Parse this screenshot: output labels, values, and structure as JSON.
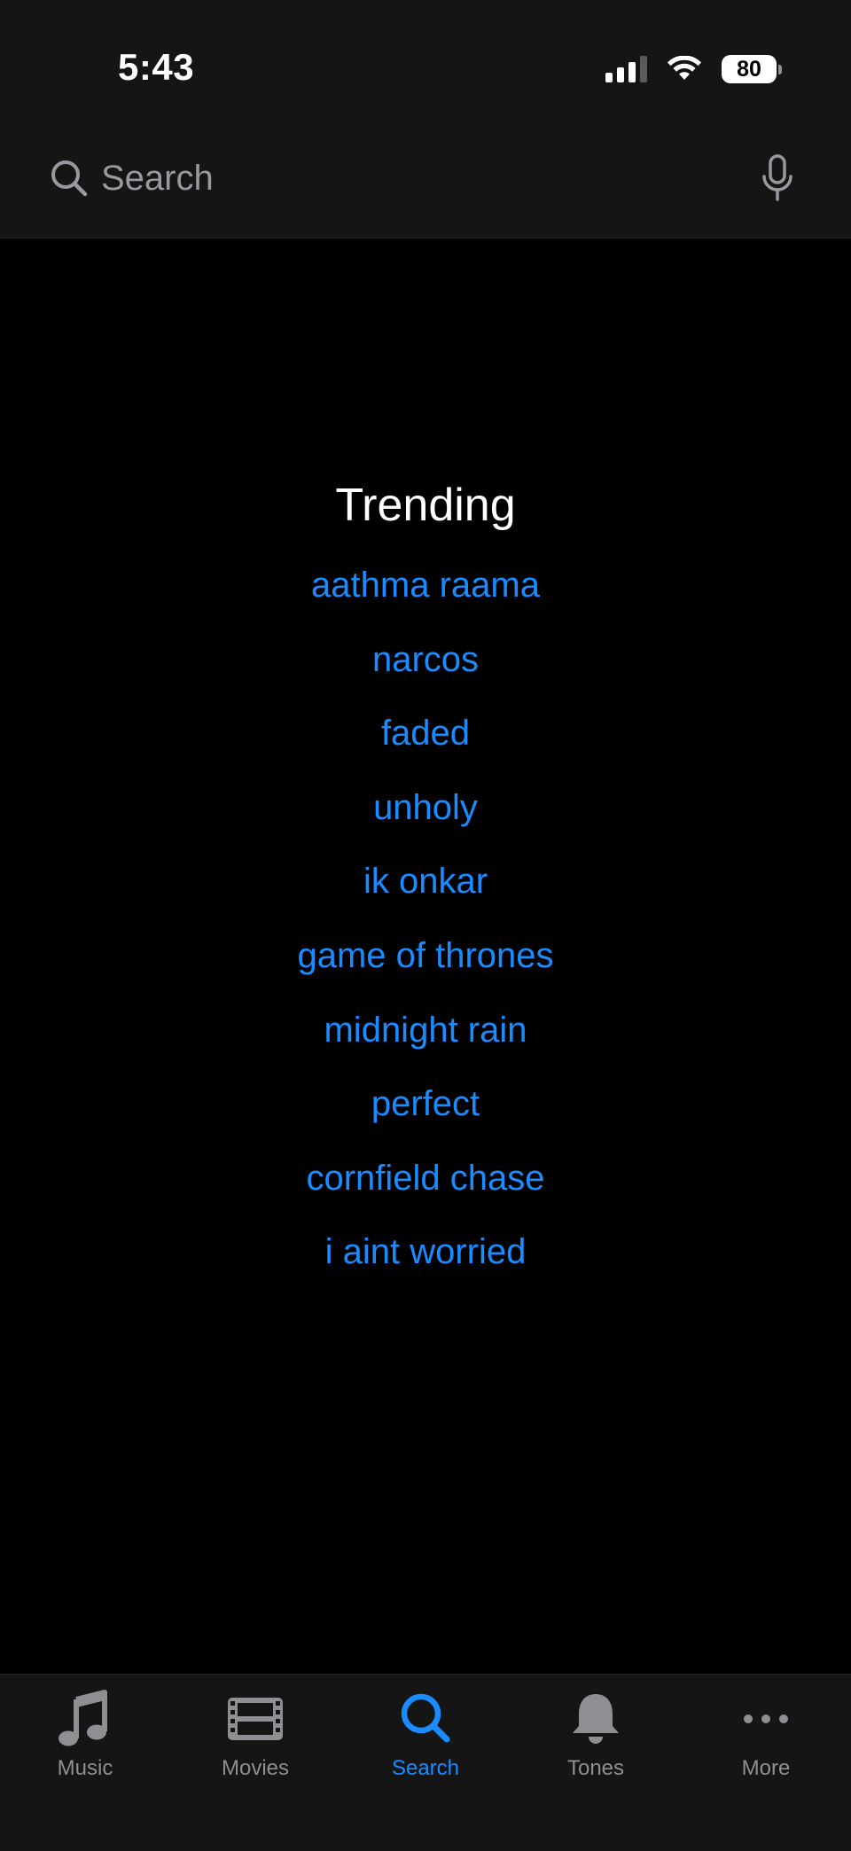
{
  "status_bar": {
    "time": "5:43",
    "battery": "80",
    "icons": [
      "signal-icon",
      "wifi-icon",
      "battery-icon"
    ]
  },
  "search": {
    "placeholder": "Search",
    "icons": [
      "search-icon",
      "mic-icon"
    ]
  },
  "trending": {
    "title": "Trending",
    "items": [
      "aathma raama",
      "narcos",
      "faded",
      "unholy",
      "ik onkar",
      "game of thrones",
      "midnight rain",
      "perfect",
      "cornfield chase",
      "i aint worried"
    ]
  },
  "tabbar": {
    "tabs": [
      {
        "label": "Music",
        "icon": "music-note-icon",
        "active": false
      },
      {
        "label": "Movies",
        "icon": "film-icon",
        "active": false
      },
      {
        "label": "Search",
        "icon": "search-icon",
        "active": true
      },
      {
        "label": "Tones",
        "icon": "bell-icon",
        "active": false
      },
      {
        "label": "More",
        "icon": "more-icon",
        "active": false
      }
    ]
  },
  "colors": {
    "background": "#000000",
    "bar_background": "#151516",
    "accent": "#1a8cff",
    "inactive": "#8e8e93",
    "placeholder": "#98989f"
  }
}
